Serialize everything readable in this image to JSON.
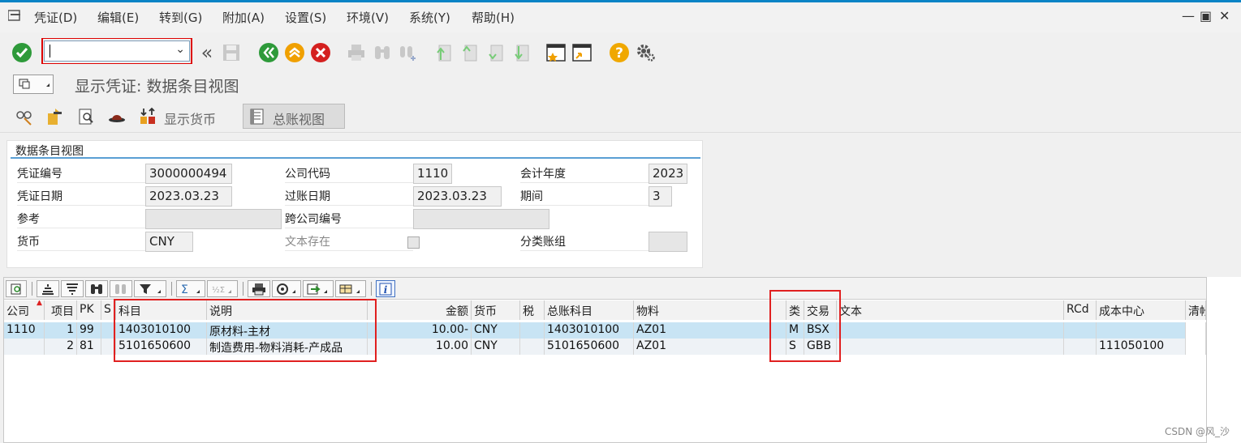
{
  "menu": {
    "items": [
      "凭证(D)",
      "编辑(E)",
      "转到(G)",
      "附加(A)",
      "设置(S)",
      "环境(V)",
      "系统(Y)",
      "帮助(H)"
    ]
  },
  "toolbar": {
    "command_value": "",
    "icons": [
      "check-icon",
      "back-double-icon",
      "save-icon",
      "back-green-icon",
      "exit-icon",
      "cancel-icon",
      "print-icon",
      "find-icon",
      "find-next-icon",
      "first-page-icon",
      "prev-page-icon",
      "next-page-icon",
      "last-page-icon",
      "new-session-icon",
      "shortcut-icon",
      "help-icon",
      "settings-icon"
    ]
  },
  "title": "显示凭证: 数据条目视图",
  "app_toolbar": {
    "display_currency": "显示货币",
    "ledger_view": "总账视图"
  },
  "header": {
    "section_title": "数据条目视图",
    "doc_number_label": "凭证编号",
    "doc_number": "3000000494",
    "company_code_label": "公司代码",
    "company_code": "1110",
    "fiscal_year_label": "会计年度",
    "fiscal_year": "2023",
    "doc_date_label": "凭证日期",
    "doc_date": "2023.03.23",
    "posting_date_label": "过账日期",
    "posting_date": "2023.03.23",
    "period_label": "期间",
    "period": "3",
    "reference_label": "参考",
    "reference": "",
    "cross_company_label": "跨公司编号",
    "cross_company": "",
    "currency_label": "货币",
    "currency": "CNY",
    "text_exists_label": "文本存在",
    "ledger_group_label": "分类账组",
    "ledger_group": ""
  },
  "grid": {
    "columns": [
      "公司",
      "项目",
      "PK",
      "S",
      "科目",
      "说明",
      "金额",
      "货币",
      "税",
      "总账科目",
      "物料",
      "类",
      "交易",
      "文本",
      "RCd",
      "成本中心",
      "清帐"
    ],
    "rows": [
      {
        "company": "1110",
        "item": "1",
        "pk": "99",
        "s": "",
        "account": "1403010100",
        "desc": "原材料-主材",
        "amount": "10.00-",
        "currency": "CNY",
        "tax": "",
        "gl": "1403010100",
        "material": "AZ01",
        "type": "M",
        "trans": "BSX",
        "text": "",
        "rcd": "",
        "cost_center": ""
      },
      {
        "company": "",
        "item": "2",
        "pk": "81",
        "s": "",
        "account": "5101650600",
        "desc": "制造费用-物料消耗-产成品",
        "amount": "10.00",
        "currency": "CNY",
        "tax": "",
        "gl": "5101650600",
        "material": "AZ01",
        "type": "S",
        "trans": "GBB",
        "text": "",
        "rcd": "",
        "cost_center": "111050100"
      }
    ]
  },
  "watermark": "CSDN @风_沙"
}
